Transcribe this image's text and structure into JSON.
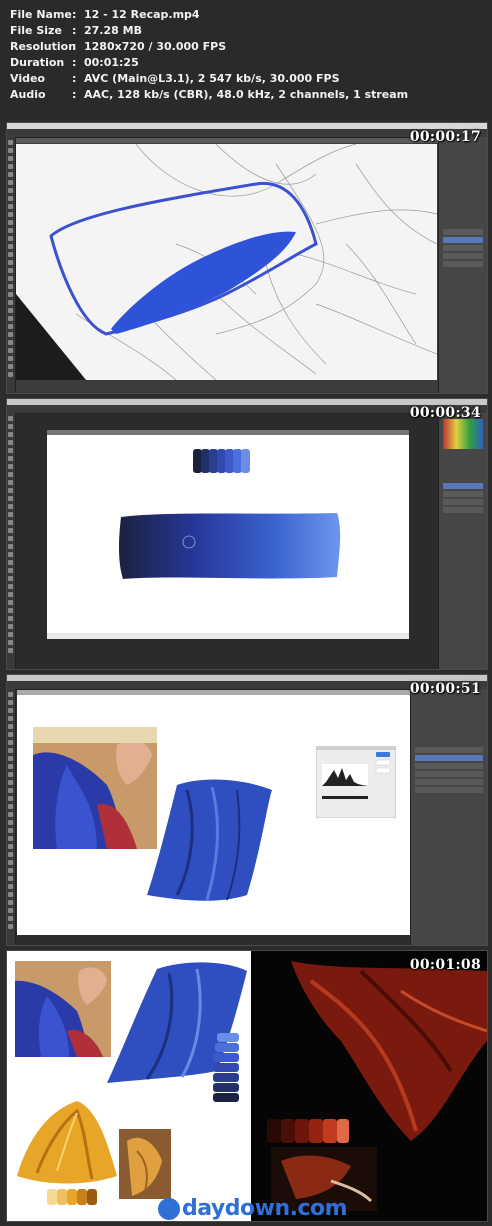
{
  "file_info": {
    "rows": [
      {
        "key": "File Name",
        "value": "12 - 12 Recap.mp4"
      },
      {
        "key": "File Size",
        "value": "27.28 MB"
      },
      {
        "key": "Resolution",
        "value": "1280x720 / 30.000 FPS"
      },
      {
        "key": "Duration",
        "value": "00:01:25"
      },
      {
        "key": "Video",
        "value": "AVC (Main@L3.1), 2 547 kb/s, 30.000 FPS"
      },
      {
        "key": "Audio",
        "value": "AAC, 128 kb/s (CBR), 48.0 kHz, 2 channels, 1 stream"
      }
    ],
    "separator": ":"
  },
  "frames": [
    {
      "timestamp": "00:00:17"
    },
    {
      "timestamp": "00:00:34"
    },
    {
      "timestamp": "00:00:51"
    },
    {
      "timestamp": "00:01:08"
    }
  ],
  "watermark": {
    "text": "daydown.com",
    "icon": "download-circle-icon"
  },
  "colors": {
    "background": "#2c2c2c",
    "text": "#f2f2f2",
    "ps_chrome": "#3a3a3a",
    "cloth_blue": "#2e4fb5",
    "watermark_blue": "#2f6fd6"
  }
}
